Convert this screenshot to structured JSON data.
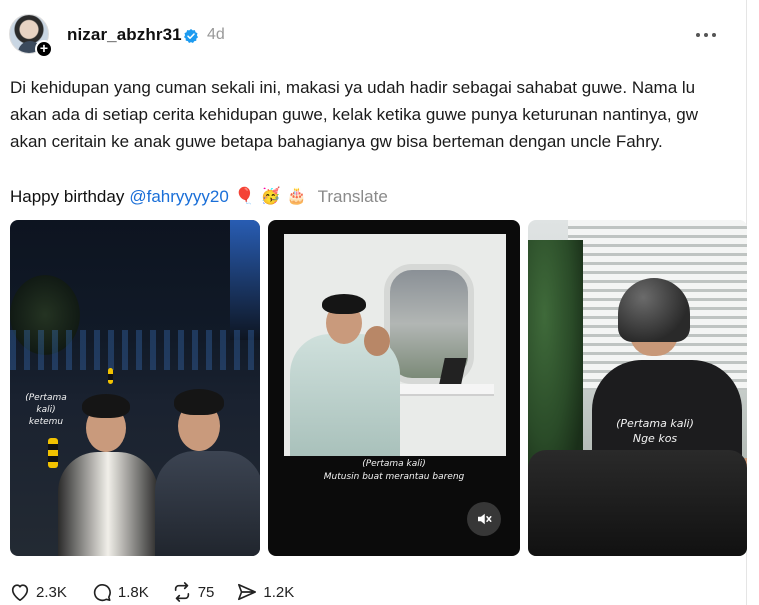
{
  "post": {
    "username": "nizar_abzhr31",
    "timestamp": "4d",
    "caption": "Di kehidupan yang cuman sekali ini, makasi ya udah hadir sebagai sahabat guwe. Nama lu akan ada di setiap cerita kehidupan guwe, kelak ketika guwe punya keturunan nantinya, gw akan ceritain ke anak guwe betapa bahagianya gw bisa berteman dengan uncle Fahry.",
    "birthday_text": "Happy birthday",
    "mention": "@fahryyyy20",
    "emojis": [
      "🎈",
      "🥳",
      "🎂"
    ],
    "translate_label": "Translate"
  },
  "media": [
    {
      "overlay_title": "(Pertama kali)",
      "overlay_sub": "ketemu"
    },
    {
      "overlay_title": "(Pertama kali)",
      "overlay_sub": "Mutusin buat merantau bareng"
    },
    {
      "overlay_title": "(Pertama kali)",
      "overlay_sub": "Nge kos"
    }
  ],
  "actions": {
    "likes": "2.3K",
    "replies": "1.8K",
    "reposts": "75",
    "shares": "1.2K"
  },
  "icons": {
    "verified": "verified-badge-icon",
    "more": "more-options-icon",
    "like": "heart-icon",
    "reply": "comment-icon",
    "repost": "repost-icon",
    "share": "share-icon",
    "mute": "speaker-muted-icon"
  },
  "colors": {
    "mention": "#1a6fd8",
    "verified": "#1d9bf0",
    "muted_text": "#999999"
  }
}
